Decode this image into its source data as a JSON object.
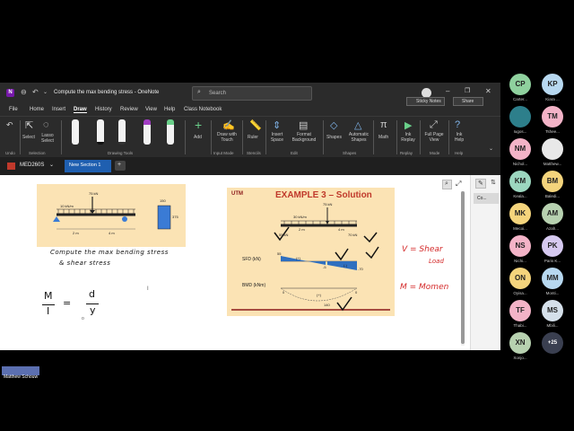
{
  "window": {
    "title": "Compute the max bending stress  -  OneNote",
    "search_placeholder": "Search"
  },
  "titlebar_buttons": {
    "sticky_notes": "Sticky Notes",
    "share": "Share"
  },
  "menu": [
    "File",
    "Home",
    "Insert",
    "Draw",
    "History",
    "Review",
    "View",
    "Help",
    "Class Notebook"
  ],
  "ribbon": {
    "tools": {
      "select": "Select",
      "lasso": "Lasso Select",
      "add": "Add",
      "draw_with_touch": "Draw with Touch",
      "ruler": "Ruler",
      "insert_space": "Insert Space",
      "format_background": "Format Background",
      "shapes": "Shapes",
      "automatic_shapes": "Automatic Shapes",
      "math": "Math",
      "ink_replay": "Ink Replay",
      "full_page_view": "Full Page View",
      "ink_help": "Ink Help"
    },
    "groups": {
      "undo": "Undo",
      "selection": "Selection",
      "drawing_tools": "Drawing Tools",
      "input_mode": "Input Mode",
      "stencils": "Stencils",
      "edit": "Edit",
      "shapes": "Shapes",
      "replay": "Replay",
      "mode": "Mode",
      "help": "Help"
    }
  },
  "notebook": {
    "name": "MED260S",
    "section": "New Section 1",
    "add_tab": "+"
  },
  "page_list": {
    "item": "Co..."
  },
  "slide1": {
    "load": "75 kN",
    "udl": "10 kN/m",
    "span_left": "2 m",
    "span_right": "4 m",
    "width": "150",
    "height": "375"
  },
  "slide2": {
    "brand": "UTM",
    "title": "EXAMPLE 3 – Solution",
    "load": "75 kN",
    "udl": "30 kN/m",
    "reaction_left": "55 kN",
    "reaction_right": "70 kN",
    "span_left": "2 m",
    "span_right": "4 m",
    "sfd_label": "SFD (kN)",
    "bmd_label": "BMD (kNm)",
    "sfd_v1": "55",
    "sfd_v2": "-5",
    "sfd_v3": "-70",
    "sfd_sign1": "(+)",
    "sfd_sign2": "(-)",
    "bmd_sign": "(+)",
    "bmd_max": "140",
    "bmd_zero1": "0",
    "bmd_zero2": "0"
  },
  "handwriting": {
    "task_line1": "Compute the max bending stress",
    "task_line2": "& shear stress",
    "formula_m": "M",
    "formula_i": "I",
    "formula_eq": "=",
    "formula_d": "d",
    "formula_y": "y",
    "v_note_1": "V = Shear",
    "v_note_2": "Load",
    "m_note": "M = Momen"
  },
  "presenter": "Matthew Schouw",
  "participants": [
    {
      "initials": "CP",
      "name": "Carter...",
      "color": "#8fd19e"
    },
    {
      "initials": "KP",
      "name": "Kiara ...",
      "color": "#b7d8f0"
    },
    {
      "initials": "",
      "name": "Iugos...",
      "color": "#2d7f8b"
    },
    {
      "initials": "TM",
      "name": "Tshee...",
      "color": "#f3b3c7"
    },
    {
      "initials": "NM",
      "name": "Nichol...",
      "color": "#f3b3c7"
    },
    {
      "initials": "",
      "name": "Matthew...",
      "color": "#e8e8e8"
    },
    {
      "initials": "KM",
      "name": "Keala...",
      "color": "#9cd6bf"
    },
    {
      "initials": "BM",
      "name": "Baledi...",
      "color": "#f4d47c"
    },
    {
      "initials": "MK",
      "name": "Mecoi...",
      "color": "#f4d47c"
    },
    {
      "initials": "AM",
      "name": "Azah...",
      "color": "#b7d1b0"
    },
    {
      "initials": "NS",
      "name": "Nichi...",
      "color": "#f3b3c7"
    },
    {
      "initials": "PK",
      "name": "Paris K...",
      "color": "#d6c9f0"
    },
    {
      "initials": "ON",
      "name": "Oyisa...",
      "color": "#f4d47c"
    },
    {
      "initials": "MM",
      "name": "Monti...",
      "color": "#b7d8f0"
    },
    {
      "initials": "TF",
      "name": "Thabi...",
      "color": "#f3b3c7"
    },
    {
      "initials": "MS",
      "name": "Mbili...",
      "color": "#d5e0ea"
    },
    {
      "initials": "XN",
      "name": "Xonjo...",
      "color": "#b7d1b0"
    },
    {
      "initials": "+25",
      "name": "",
      "color": "#3a3f50"
    }
  ]
}
